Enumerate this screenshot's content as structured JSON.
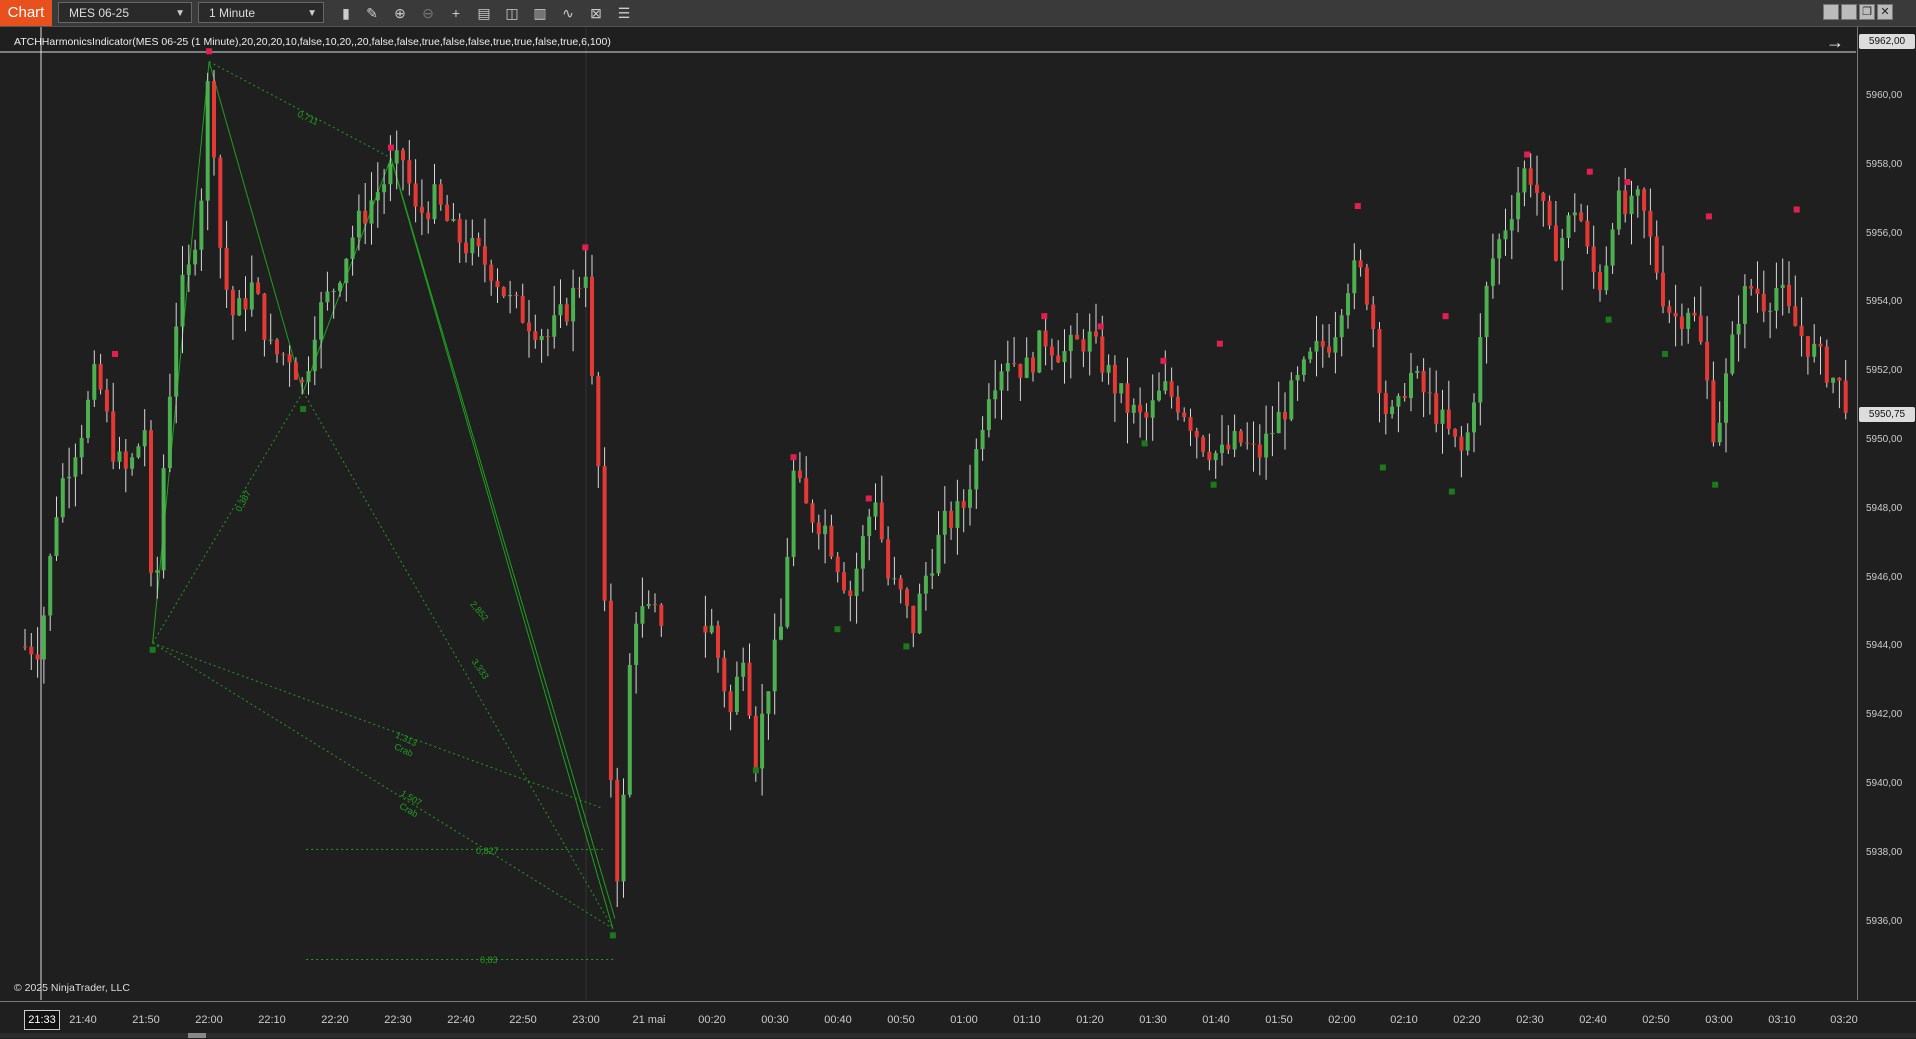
{
  "toolbar": {
    "chart_tab": "Chart",
    "instrument": "MES 06-25",
    "interval": "1 Minute",
    "tools": [
      "bar-type-icon",
      "pencil-icon",
      "zoom-in-icon",
      "zoom-out-icon",
      "crosshair-icon",
      "data-box-icon",
      "properties-icon",
      "templates-icon",
      "strategies-icon",
      "indicators-icon",
      "list-icon"
    ],
    "window_buttons": [
      "restore-icon",
      "maximize-icon",
      "tile-icon",
      "close-icon"
    ]
  },
  "indicator_label": "ATCHHarmonicsIndicator(MES 06-25 (1 Minute),20,20,20,10,false,10,20,,20,false,false,true,false,false,true,true,false,true,6,100)",
  "copyright": "© 2025 NinjaTrader, LLC",
  "price_axis": {
    "labels": [
      "5960,00",
      "5958,00",
      "5956,00",
      "5954,00",
      "5952,00",
      "5950,00",
      "5948,00",
      "5946,00",
      "5944,00",
      "5942,00",
      "5940,00",
      "5938,00",
      "5936,00"
    ],
    "top_tag": "5962,00",
    "last_price_tag": "5950,75"
  },
  "time_axis": {
    "cursor": "21:33",
    "labels": [
      "21:40",
      "21:50",
      "22:00",
      "22:10",
      "22:20",
      "22:30",
      "22:40",
      "22:50",
      "23:00",
      "21 mai",
      "00:20",
      "00:30",
      "00:40",
      "00:50",
      "01:00",
      "01:10",
      "01:20",
      "01:30",
      "01:40",
      "01:50",
      "02:00",
      "02:10",
      "02:20",
      "02:30",
      "02:40",
      "02:50",
      "03:00",
      "03:10",
      "03:20"
    ]
  },
  "pattern_labels": [
    "0,711",
    "0,387",
    "2,852",
    "3,333",
    "1,313",
    "Crab",
    "1,507",
    "Crab",
    "0,827",
    "0,83"
  ],
  "colors": {
    "up": "#4caf50",
    "down": "#e53935",
    "pattern": "#1fa01f",
    "swing_high": "#e02050",
    "swing_low": "#1b7a1b",
    "accent": "#e8501e"
  },
  "chart_data": {
    "type": "candlestick",
    "ylim": [
      5935,
      5962.5
    ],
    "x_range": [
      "21:33",
      "03:23"
    ],
    "price_path": [
      [
        "21:33",
        5944.0
      ],
      [
        "21:36",
        5948.5
      ],
      [
        "21:40",
        5950.5
      ],
      [
        "21:42",
        5952.0
      ],
      [
        "21:45",
        5949.5
      ],
      [
        "21:47",
        5949.0
      ],
      [
        "21:50",
        5950.5
      ],
      [
        "21:51",
        5944.0
      ],
      [
        "21:53",
        5950.0
      ],
      [
        "21:55",
        5954.0
      ],
      [
        "21:57",
        5955.0
      ],
      [
        "21:59",
        5957.5
      ],
      [
        "22:00",
        5961.0
      ],
      [
        "22:02",
        5955.0
      ],
      [
        "22:04",
        5953.5
      ],
      [
        "22:07",
        5954.5
      ],
      [
        "22:10",
        5952.5
      ],
      [
        "22:13",
        5952.5
      ],
      [
        "22:15",
        5951.5
      ],
      [
        "22:17",
        5953.5
      ],
      [
        "22:20",
        5954.5
      ],
      [
        "22:23",
        5956.0
      ],
      [
        "22:26",
        5957.0
      ],
      [
        "22:29",
        5957.8
      ],
      [
        "22:31",
        5958.2
      ],
      [
        "22:33",
        5956.5
      ],
      [
        "22:36",
        5957.0
      ],
      [
        "22:39",
        5956.0
      ],
      [
        "22:42",
        5955.5
      ],
      [
        "22:45",
        5955.0
      ],
      [
        "22:48",
        5954.0
      ],
      [
        "22:51",
        5953.5
      ],
      [
        "22:54",
        5953.0
      ],
      [
        "22:57",
        5953.8
      ],
      [
        "23:00",
        5955.0
      ],
      [
        "23:01",
        5955.3
      ],
      [
        "23:03",
        5952.0
      ],
      [
        "23:05",
        5951.0
      ],
      [
        "23:07",
        5952.5
      ],
      [
        "23:09",
        5944.0
      ],
      [
        "23:11",
        5948.0
      ],
      [
        "23:13",
        5940.0
      ],
      [
        "23:15",
        5943.0
      ],
      [
        "23:17",
        5935.8
      ],
      [
        "23:19",
        5939.0
      ],
      [
        "23:20",
        5937.0
      ],
      [
        "23:22",
        5936.0
      ],
      [
        "23:24",
        5940.0
      ],
      [
        "23:26",
        5942.5
      ],
      [
        "23:28",
        5943.5
      ],
      [
        "23:30",
        5945.0
      ],
      [
        "00:20",
        5944.5
      ],
      [
        "00:23",
        5942.0
      ],
      [
        "00:25",
        5944.0
      ],
      [
        "00:27",
        5940.8
      ],
      [
        "00:29",
        5943.0
      ],
      [
        "00:31",
        5944.5
      ],
      [
        "00:33",
        5949.0
      ],
      [
        "00:35",
        5948.0
      ],
      [
        "00:38",
        5947.5
      ],
      [
        "00:40",
        5946.5
      ],
      [
        "00:42",
        5945.5
      ],
      [
        "00:44",
        5947.0
      ],
      [
        "00:46",
        5948.5
      ],
      [
        "00:48",
        5946.0
      ],
      [
        "00:50",
        5945.5
      ],
      [
        "00:52",
        5944.5
      ],
      [
        "00:54",
        5946.0
      ],
      [
        "00:57",
        5947.5
      ],
      [
        "01:00",
        5948.0
      ],
      [
        "01:02",
        5949.5
      ],
      [
        "01:04",
        5951.5
      ],
      [
        "01:07",
        5952.5
      ],
      [
        "01:10",
        5952.0
      ],
      [
        "01:13",
        5953.0
      ],
      [
        "01:16",
        5952.5
      ],
      [
        "01:20",
        5953.0
      ],
      [
        "01:23",
        5952.0
      ],
      [
        "01:26",
        5951.0
      ],
      [
        "01:29",
        5950.5
      ],
      [
        "01:32",
        5951.5
      ],
      [
        "01:35",
        5951.0
      ],
      [
        "01:38",
        5950.0
      ],
      [
        "01:41",
        5949.5
      ],
      [
        "01:44",
        5950.0
      ],
      [
        "01:47",
        5949.5
      ],
      [
        "01:50",
        5950.5
      ],
      [
        "01:53",
        5951.5
      ],
      [
        "01:56",
        5952.5
      ],
      [
        "01:59",
        5953.0
      ],
      [
        "02:01",
        5954.5
      ],
      [
        "02:03",
        5955.0
      ],
      [
        "02:05",
        5954.0
      ],
      [
        "02:07",
        5951.0
      ],
      [
        "02:09",
        5950.5
      ],
      [
        "02:11",
        5952.0
      ],
      [
        "02:13",
        5951.5
      ],
      [
        "02:15",
        5951.0
      ],
      [
        "02:18",
        5950.0
      ],
      [
        "02:20",
        5949.5
      ],
      [
        "02:22",
        5952.0
      ],
      [
        "02:24",
        5955.0
      ],
      [
        "02:26",
        5956.0
      ],
      [
        "02:28",
        5957.0
      ],
      [
        "02:30",
        5958.0
      ],
      [
        "02:32",
        5957.0
      ],
      [
        "02:34",
        5955.5
      ],
      [
        "02:36",
        5956.0
      ],
      [
        "02:38",
        5957.0
      ],
      [
        "02:40",
        5955.0
      ],
      [
        "02:42",
        5954.5
      ],
      [
        "02:44",
        5957.0
      ],
      [
        "02:46",
        5956.5
      ],
      [
        "02:48",
        5957.0
      ],
      [
        "02:50",
        5955.5
      ],
      [
        "02:52",
        5954.0
      ],
      [
        "02:54",
        5953.5
      ],
      [
        "02:56",
        5954.0
      ],
      [
        "02:58",
        5952.5
      ],
      [
        "03:00",
        5950.0
      ],
      [
        "03:02",
        5952.0
      ],
      [
        "03:04",
        5954.0
      ],
      [
        "03:06",
        5954.5
      ],
      [
        "03:08",
        5954.0
      ],
      [
        "03:10",
        5954.5
      ],
      [
        "03:12",
        5953.5
      ],
      [
        "03:14",
        5953.0
      ],
      [
        "03:16",
        5952.5
      ],
      [
        "03:18",
        5952.0
      ],
      [
        "03:20",
        5951.5
      ],
      [
        "03:22",
        5950.75
      ]
    ],
    "swing_highs": [
      [
        "21:45",
        5952.5
      ],
      [
        "22:00",
        5961.3
      ],
      [
        "22:29",
        5958.5
      ],
      [
        "23:00",
        5955.6
      ],
      [
        "00:33",
        5949.5
      ],
      [
        "00:45",
        5948.3
      ],
      [
        "01:13",
        5953.6
      ],
      [
        "01:22",
        5953.3
      ],
      [
        "01:32",
        5952.3
      ],
      [
        "01:41",
        5952.8
      ],
      [
        "02:03",
        5956.8
      ],
      [
        "02:17",
        5953.6
      ],
      [
        "02:30",
        5958.3
      ],
      [
        "02:40",
        5957.8
      ],
      [
        "02:46",
        5957.5
      ],
      [
        "02:59",
        5956.5
      ],
      [
        "03:13",
        5956.7
      ]
    ],
    "swing_lows": [
      [
        "21:51",
        5943.9
      ],
      [
        "22:15",
        5950.9
      ],
      [
        "23:17",
        5935.6
      ],
      [
        "00:27",
        5940.4
      ],
      [
        "00:40",
        5944.5
      ],
      [
        "00:51",
        5944.0
      ],
      [
        "01:29",
        5949.9
      ],
      [
        "01:40",
        5948.7
      ],
      [
        "02:07",
        5949.2
      ],
      [
        "02:18",
        5948.5
      ],
      [
        "02:43",
        5953.5
      ],
      [
        "02:52",
        5952.5
      ],
      [
        "03:00",
        5948.7
      ]
    ],
    "pattern": {
      "name": "Crab",
      "X": [
        "21:51",
        5944.1
      ],
      "A": [
        "22:00",
        5961.0
      ],
      "B": [
        "22:15",
        5951.4
      ],
      "C": [
        "22:29",
        5958.2
      ],
      "D": [
        "23:17",
        5935.8
      ],
      "ratios": {
        "XAB": "0,711",
        "BCD_a": "2,852",
        "BCD_b": "3,333",
        "XAD_a": "1,313",
        "XAD_b": "1,507",
        "box_a": "0,827",
        "box_b": "0,83"
      }
    }
  }
}
